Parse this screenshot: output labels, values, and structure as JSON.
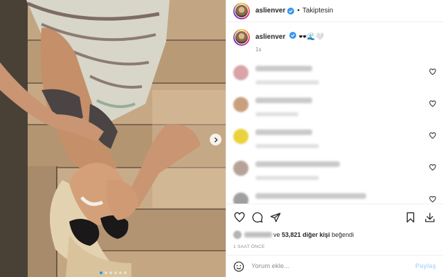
{
  "header": {
    "username": "aslienver",
    "separator": "•",
    "follow_status": "Takiptesin",
    "more": "···"
  },
  "caption": {
    "username": "aslienver",
    "text": "🕶️🌊🤍",
    "time": "1s"
  },
  "comments": [
    {
      "avatar_color": "#d9a3a8"
    },
    {
      "avatar_color": "#c9a07c"
    },
    {
      "avatar_color": "#e9d23b"
    },
    {
      "avatar_color": "#b5a397"
    },
    {
      "avatar_color": "#9f9f9f"
    }
  ],
  "likes": {
    "text_prefix": "ve",
    "count": "53,821",
    "text_suffix_1": "diğer kişi",
    "text_suffix_2": "beğendi"
  },
  "post_time": "1 SAAT ÖNCE",
  "comment_input": {
    "placeholder": "Yorum ekle...",
    "post_label": "Paylaş"
  },
  "carousel": {
    "count": 6,
    "active_index": 0
  },
  "colors": {
    "accent": "#0095f6",
    "verified": "#3897f0",
    "post_disabled": "#b3dbff"
  },
  "icons": [
    "verified-icon",
    "heart-icon",
    "comment-icon",
    "share-icon",
    "bookmark-icon",
    "download-icon",
    "emoji-icon",
    "chevron-right-icon"
  ]
}
